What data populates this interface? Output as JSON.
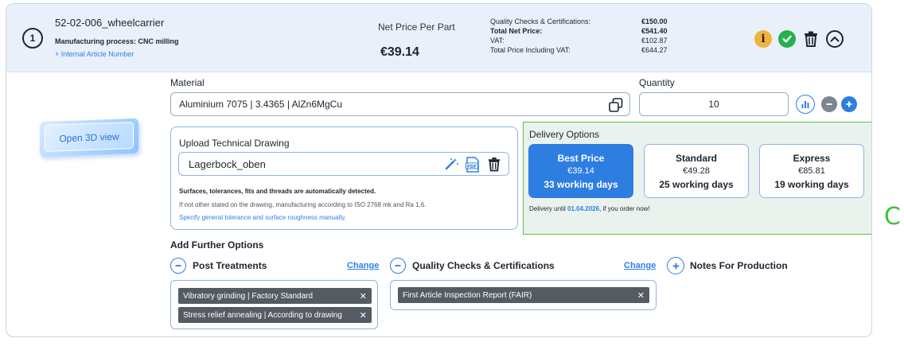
{
  "item": {
    "position": "1",
    "part_name": "52-02-006_wheelcarrier",
    "process": "Manufacturing process: CNC milling",
    "article_link": "+ Internal Article Number"
  },
  "pricing": {
    "net_price_label": "Net Price Per Part",
    "net_price_value": "€39.14",
    "rows": [
      {
        "label": "Quality Checks & Certifications:",
        "value": "€150.00"
      },
      {
        "label": "Total Net Price:",
        "value": "€541.40"
      },
      {
        "label": "VAT:",
        "value": "€102.87"
      },
      {
        "label": "Total Price Including VAT:",
        "value": "€644.27"
      }
    ]
  },
  "actions": {
    "icons": [
      "info-icon",
      "check-icon",
      "trash-icon",
      "collapse-icon"
    ],
    "colors": {
      "info": "#f2b33d",
      "ok": "#22b14c"
    }
  },
  "viewer": {
    "open_3d_label": "Open 3D view"
  },
  "material": {
    "label": "Material",
    "value": "Aluminium 7075 | 3.4365 | AlZn6MgCu"
  },
  "quantity": {
    "label": "Quantity",
    "value": "10"
  },
  "upload": {
    "title": "Upload Technical Drawing",
    "file_name": "Lagerbock_oben",
    "note_bold": "Surfaces, tolerances, fits and threads are automatically detected.",
    "note": "If not other stated on the drawing, manufacturing according to ISO 2768 mk and Ra 1,6.",
    "link": "Specify general tolerance and surface roughness manually."
  },
  "delivery": {
    "title": "Delivery Options",
    "options": [
      {
        "title": "Best Price",
        "price": "€39.14",
        "days": "33 working days"
      },
      {
        "title": "Standard",
        "price": "€49.28",
        "days": "25 working days"
      },
      {
        "title": "Express",
        "price": "€85.81",
        "days": "19 working days"
      }
    ],
    "until_prefix": "Delivery until",
    "until_date": "01.04.2026",
    "until_suffix": ", if you order now!",
    "accent": "#2e7de1"
  },
  "further": {
    "title": "Add Further Options",
    "post_treatments": {
      "label": "Post Treatments",
      "change": "Change",
      "chips": [
        "Vibratory grinding | Factory Standard",
        "Stress relief annealing | According to drawing"
      ]
    },
    "quality": {
      "label": "Quality Checks & Certifications",
      "change": "Change",
      "chips": [
        "First Article Inspection Report (FAIR)"
      ]
    },
    "notes": {
      "label": "Notes For Production"
    }
  },
  "side_letter": "C"
}
